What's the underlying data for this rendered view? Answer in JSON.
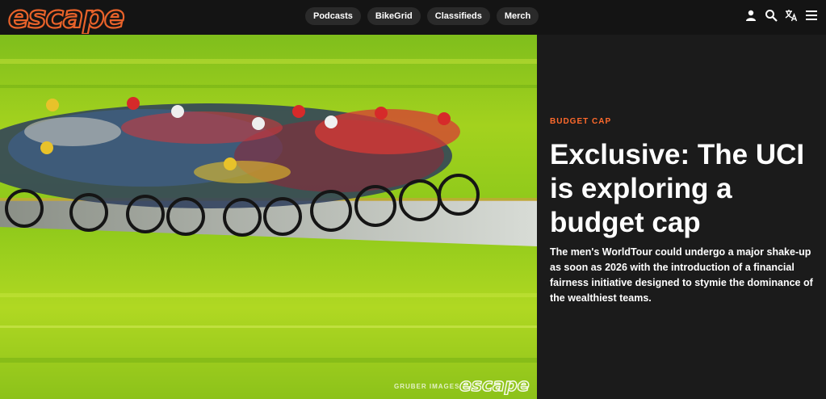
{
  "header": {
    "logo_text": "escape",
    "nav": [
      {
        "label": "Podcasts"
      },
      {
        "label": "BikeGrid"
      },
      {
        "label": "Classifieds"
      },
      {
        "label": "Merch"
      }
    ],
    "icons": [
      "user-icon",
      "search-icon",
      "translate-icon",
      "menu-icon"
    ]
  },
  "hero": {
    "image_subject": "blurred peloton of cyclists on a road with green grass",
    "credit": "GRUBER IMAGES",
    "watermark": "escape"
  },
  "article": {
    "kicker": "BUDGET CAP",
    "headline": "Exclusive: The UCI is exploring a budget cap",
    "dek": "The men's WorldTour could undergo a major shake-up as soon as 2026 with the introduction of a financial fairness initiative designed to stymie the dominance of the wealthiest teams."
  },
  "colors": {
    "brand": "#e8622a",
    "accent": "#ff6a2c",
    "background": "#141414",
    "panel": "#1b1b1b"
  }
}
